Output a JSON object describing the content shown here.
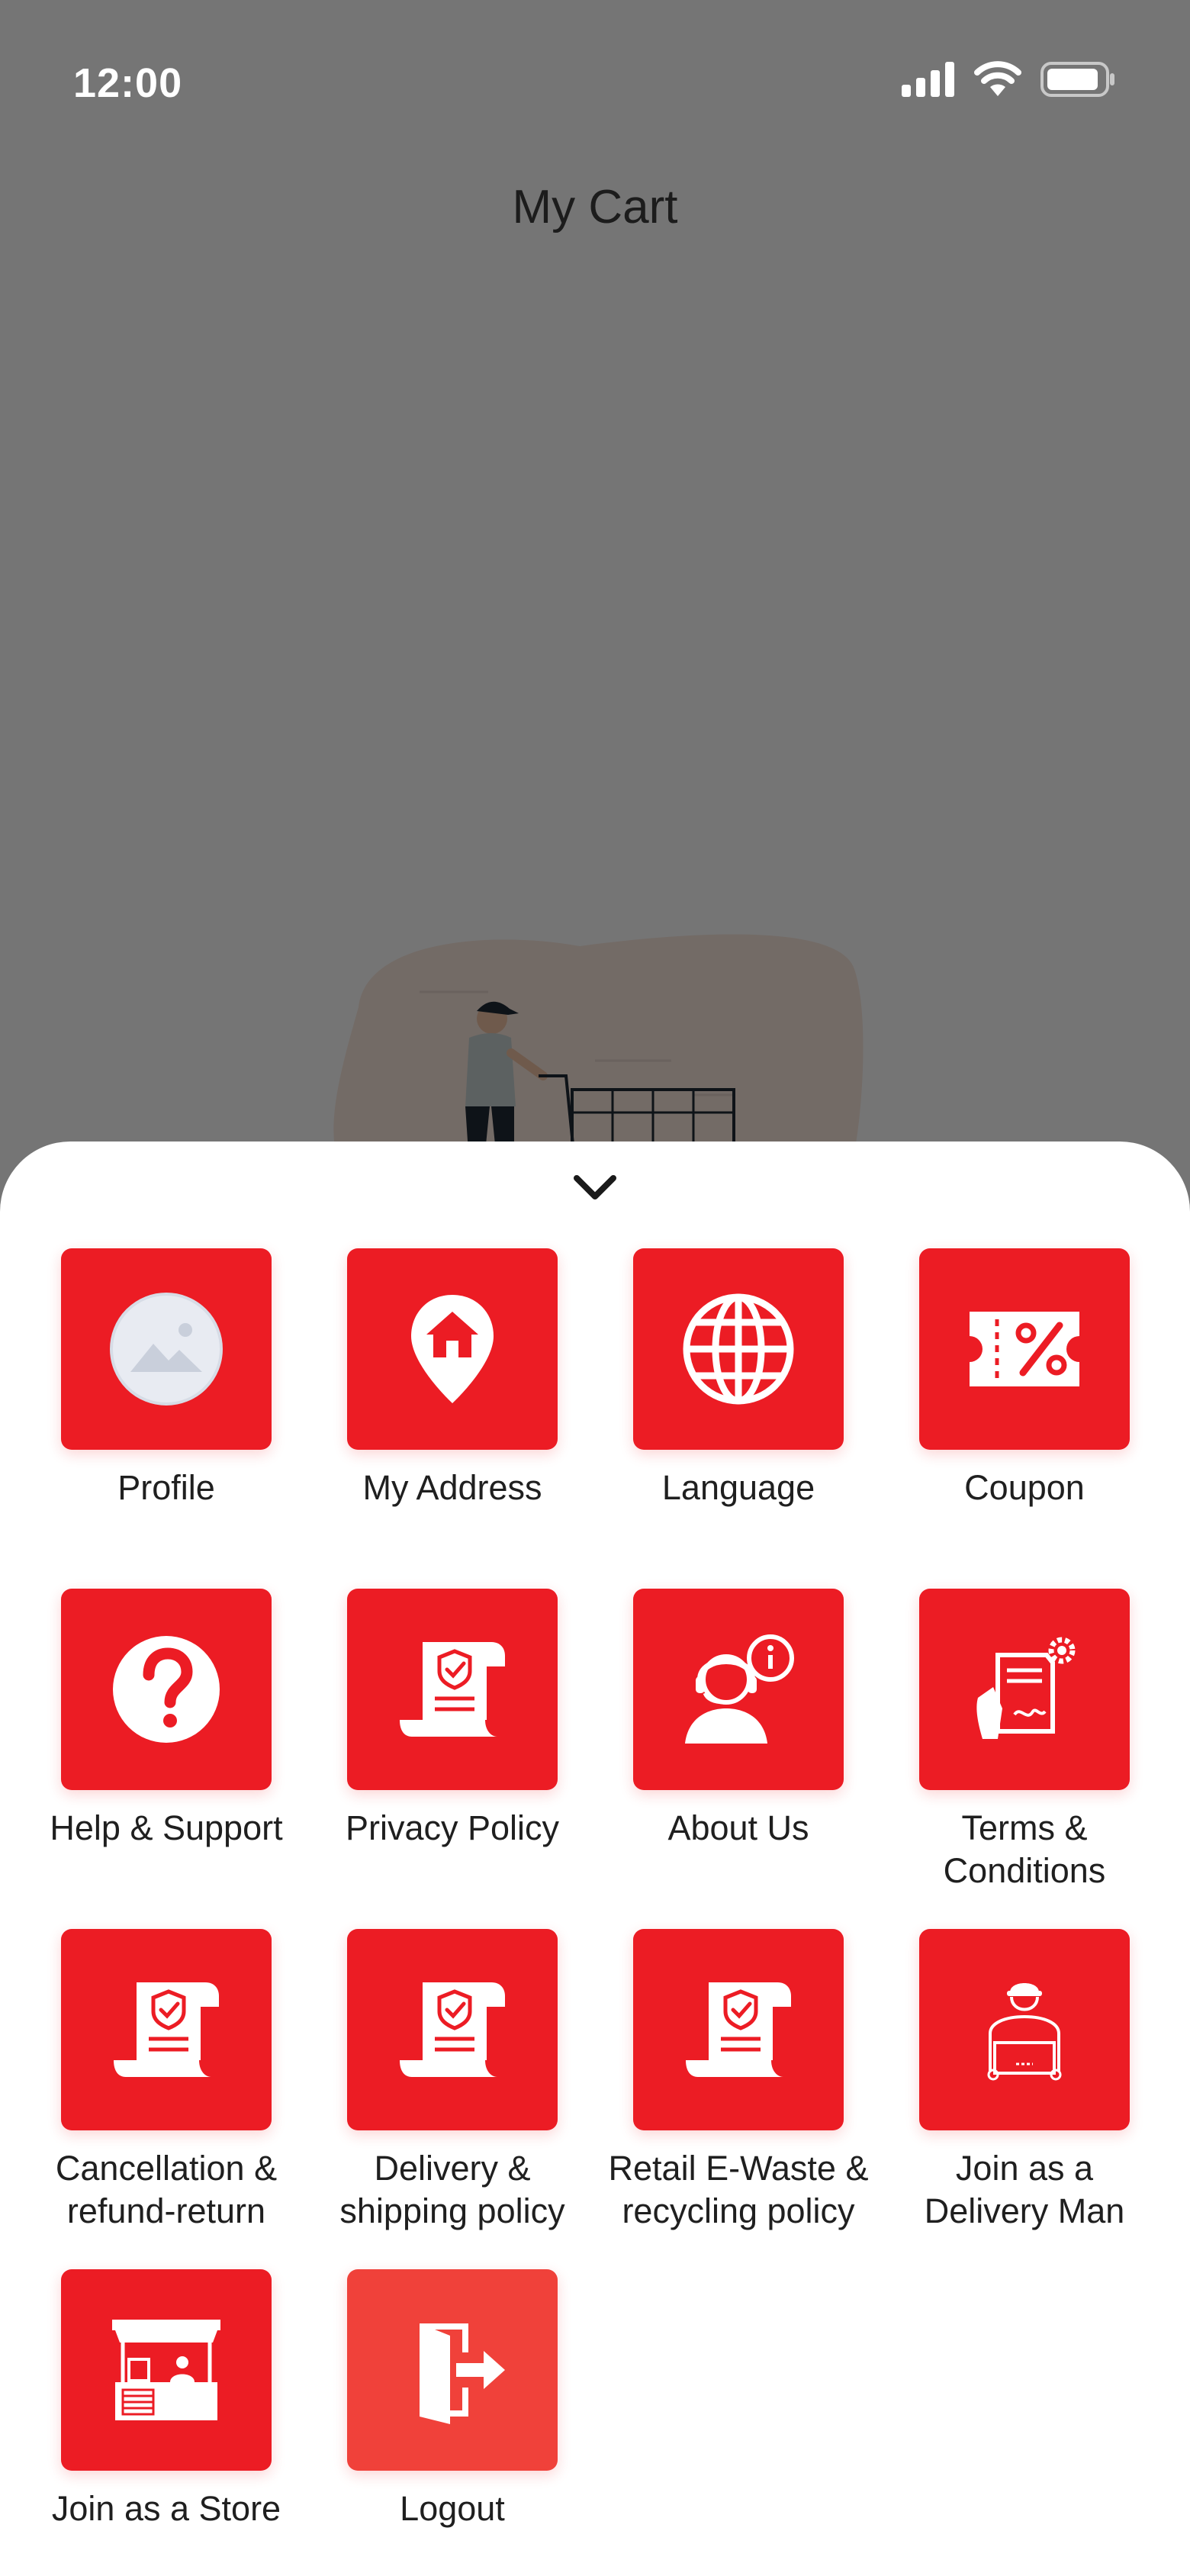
{
  "status_bar": {
    "time": "12:00"
  },
  "page": {
    "title": "My Cart"
  },
  "menu": {
    "items": [
      {
        "label": "Profile",
        "icon": "profile-placeholder-icon"
      },
      {
        "label": "My Address",
        "icon": "location-home-icon"
      },
      {
        "label": "Language",
        "icon": "globe-icon"
      },
      {
        "label": "Coupon",
        "icon": "coupon-ticket-icon"
      },
      {
        "label": "Help & Support",
        "icon": "question-icon"
      },
      {
        "label": "Privacy Policy",
        "icon": "policy-scroll-icon"
      },
      {
        "label": "About Us",
        "icon": "support-agent-icon"
      },
      {
        "label": "Terms &\nConditions",
        "icon": "contract-sign-icon"
      },
      {
        "label": "Cancellation &\nrefund-return",
        "icon": "policy-scroll-icon"
      },
      {
        "label": "Delivery &\nshipping policy",
        "icon": "policy-scroll-icon"
      },
      {
        "label": "Retail E-Waste &\nrecycling policy",
        "icon": "policy-scroll-icon"
      },
      {
        "label": "Join as a\nDelivery Man",
        "icon": "delivery-man-icon"
      },
      {
        "label": "Join as a Store",
        "icon": "store-icon"
      },
      {
        "label": "Logout",
        "icon": "logout-door-icon"
      }
    ]
  },
  "colors": {
    "tile_red": "#ec1c24",
    "logout_red": "#f0413a",
    "overlay": "#737373"
  }
}
